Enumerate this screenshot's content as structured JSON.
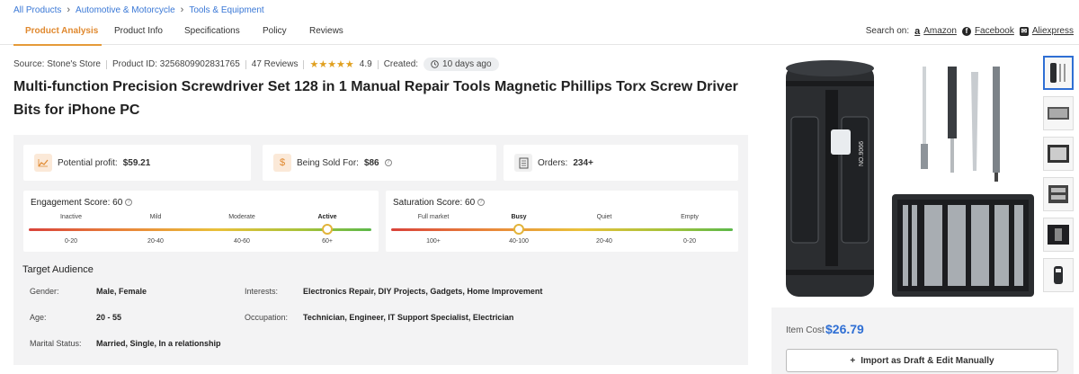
{
  "breadcrumb": [
    "All Products",
    "Automotive & Motorcycle",
    "Tools & Equipment"
  ],
  "tabs": [
    "Product Analysis",
    "Product Info",
    "Specifications",
    "Policy",
    "Reviews"
  ],
  "search_on": {
    "label": "Search on:",
    "links": [
      "Amazon",
      "Facebook",
      "Aliexpress"
    ]
  },
  "meta": {
    "source": "Source: Stone's Store",
    "product_id": "Product ID: 3256809902831765",
    "reviews": "47 Reviews",
    "rating": "4.9",
    "created_label": "Created:",
    "created_value": "10 days ago"
  },
  "title": "Multi-function Precision Screwdriver Set 128 in 1 Manual Repair Tools Magnetic Phillips Torx Screw Driver Bits for iPhone PC",
  "stats": {
    "profit_label": "Potential profit:",
    "profit_value": "$59.21",
    "sold_label": "Being Sold For:",
    "sold_value": "$86",
    "orders_label": "Orders:",
    "orders_value": "234+"
  },
  "engagement": {
    "label": "Engagement Score: 60",
    "levels": [
      "Inactive",
      "Mild",
      "Moderate",
      "Active"
    ],
    "ranges": [
      "0-20",
      "20-40",
      "40-60",
      "60+"
    ],
    "active_index": 3
  },
  "saturation": {
    "label": "Saturation Score: 60",
    "levels": [
      "Full market",
      "Busy",
      "Quiet",
      "Empty"
    ],
    "ranges": [
      "100+",
      "40-100",
      "20-40",
      "0-20"
    ],
    "active_index": 1
  },
  "audience": {
    "title": "Target Audience",
    "gender_label": "Gender:",
    "gender": "Male, Female",
    "interests_label": "Interests:",
    "interests": "Electronics Repair, DIY Projects, Gadgets, Home Improvement",
    "age_label": "Age:",
    "age": "20 - 55",
    "occupation_label": "Occupation:",
    "occupation": "Technician, Engineer, IT Support Specialist, Electrician",
    "marital_label": "Marital Status:",
    "marital": "Married, Single, In a relationship"
  },
  "product_image": {
    "case_text": "NO.9066"
  },
  "price": {
    "label": "Item Cost",
    "value": "$26.79"
  },
  "import_button": "Import as Draft & Edit Manually",
  "colors": {
    "accent": "#e0892f",
    "link": "#3a78d6",
    "price": "#2f6fd4"
  }
}
